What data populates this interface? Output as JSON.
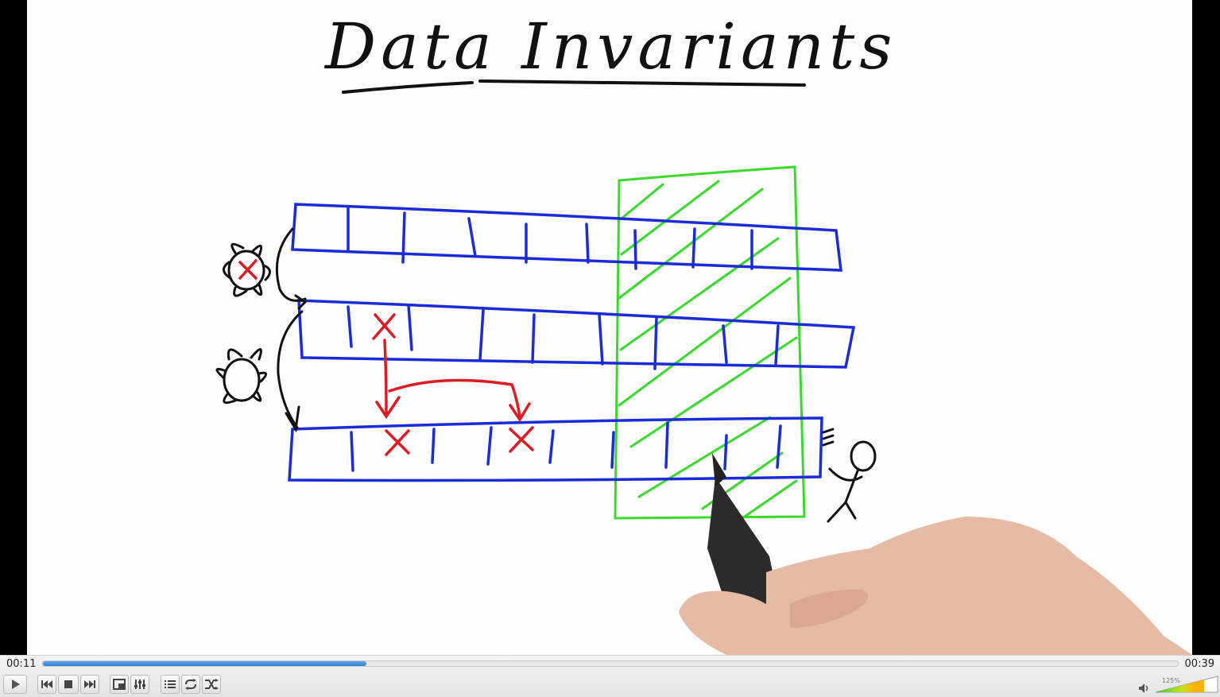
{
  "lesson": {
    "title": "Data Invariants"
  },
  "player": {
    "current_time": "00:11",
    "total_time": "00:39",
    "progress": 0.285,
    "volume_label": "125%",
    "volume_level": 1.0
  },
  "colors": {
    "array_blue": "#1b2bd6",
    "lock_green": "#3ad92e",
    "mark_red": "#dd1b24",
    "seek_blue": "#3a8ee0"
  },
  "icons": {
    "play": "play-icon",
    "prev": "previous-icon",
    "stop": "stop-icon",
    "next": "next-icon",
    "fullscreen": "fullscreen-icon",
    "extended": "extended-settings-icon",
    "playlist": "playlist-icon",
    "loop": "loop-icon",
    "shuffle": "shuffle-icon",
    "volume": "speaker-icon"
  }
}
